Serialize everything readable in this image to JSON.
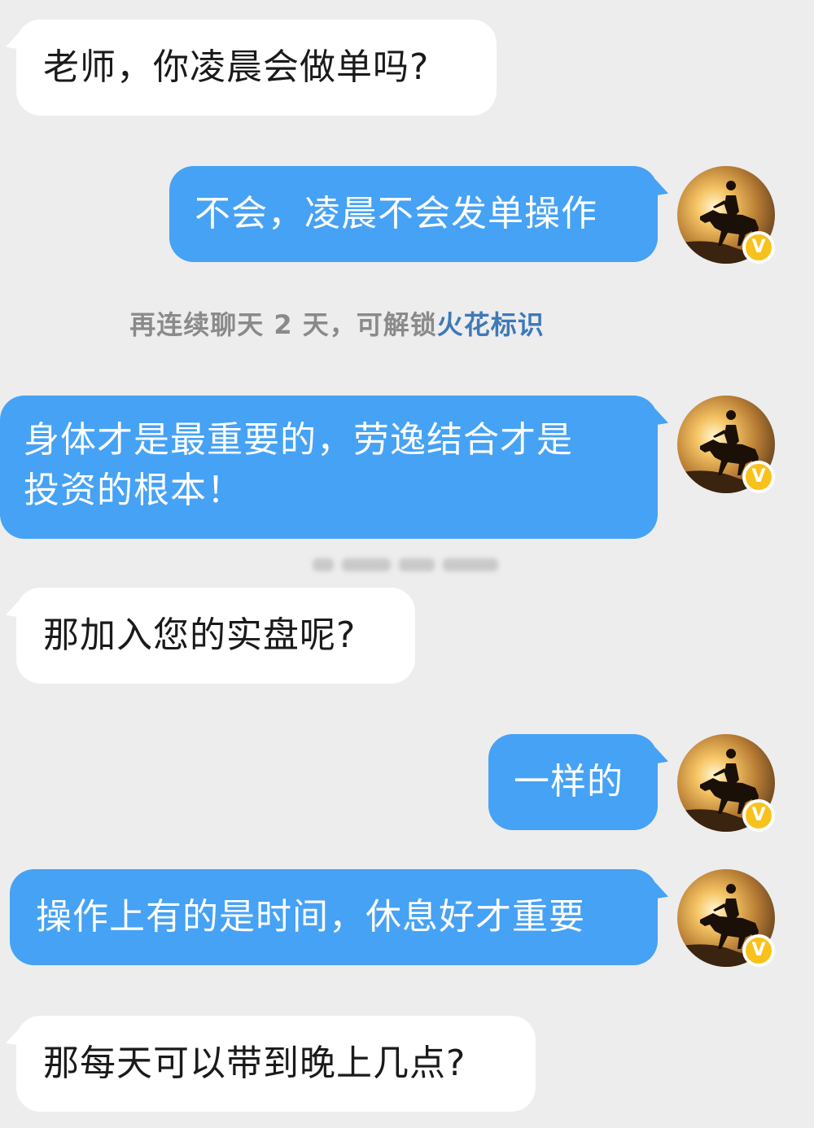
{
  "messages": [
    {
      "side": "left",
      "text": "老师，你凌晨会做单吗?"
    },
    {
      "side": "right",
      "text": "不会，凌晨不会发单操作"
    },
    {
      "side": "right",
      "lines": [
        "身体才是最重要的，劳逸结合才是",
        "投资的根本！"
      ]
    },
    {
      "side": "left",
      "text": "那加入您的实盘呢?"
    },
    {
      "side": "right",
      "text": "一样的"
    },
    {
      "side": "right",
      "text": "操作上有的是时间，休息好才重要"
    },
    {
      "side": "left",
      "text": "那每天可以带到晚上几点?"
    }
  ],
  "notice": {
    "text": "再连续聊天 2 天，可解锁",
    "link": "火花标识"
  },
  "avatar": {
    "description_icon": "horse-rider-sunset-avatar",
    "badge": "V",
    "badge_color": "#f8c21c"
  },
  "colors": {
    "background": "#ededed",
    "right_bubble": "#46a2f4",
    "left_bubble": "#ffffff",
    "link": "#3e79b8"
  }
}
